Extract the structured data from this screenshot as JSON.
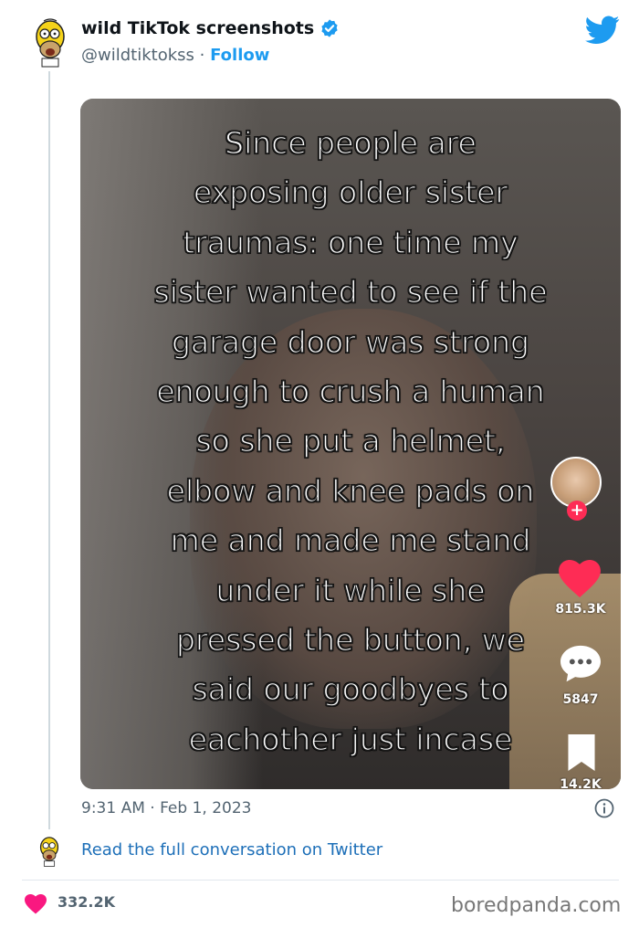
{
  "header": {
    "display_name": "wild TikTok screenshots",
    "handle": "@wildtiktokss",
    "separator": "·",
    "follow_label": "Follow"
  },
  "media": {
    "caption_lines": [
      "Since people are",
      "exposing older sister",
      "traumas: one time my",
      "sister wanted to see if the",
      "garage door was strong",
      "enough to crush a human",
      "so she put a helmet,",
      "elbow and knee pads on",
      "me and made me stand",
      "under it while she",
      "pressed the button, we",
      "said our goodbyes to",
      "eachother just incase"
    ],
    "tiktok": {
      "follow_plus": "+",
      "likes": "815.3K",
      "comments": "5847",
      "saves": "14.2K"
    }
  },
  "footer": {
    "timestamp": "9:31 AM · Feb 1, 2023",
    "read_conversation": "Read the full conversation on Twitter",
    "like_count": "332.2K",
    "watermark": "boredpanda.com"
  },
  "colors": {
    "twitter_blue": "#1d9bf0",
    "like_red": "#f91880",
    "tiktok_red": "#fe2c55"
  },
  "icons": [
    "homer-avatar-icon",
    "verified-badge-icon",
    "twitter-bird-icon",
    "info-icon",
    "heart-icon",
    "tiktok-heart-icon",
    "tiktok-comment-icon",
    "tiktok-bookmark-icon"
  ]
}
